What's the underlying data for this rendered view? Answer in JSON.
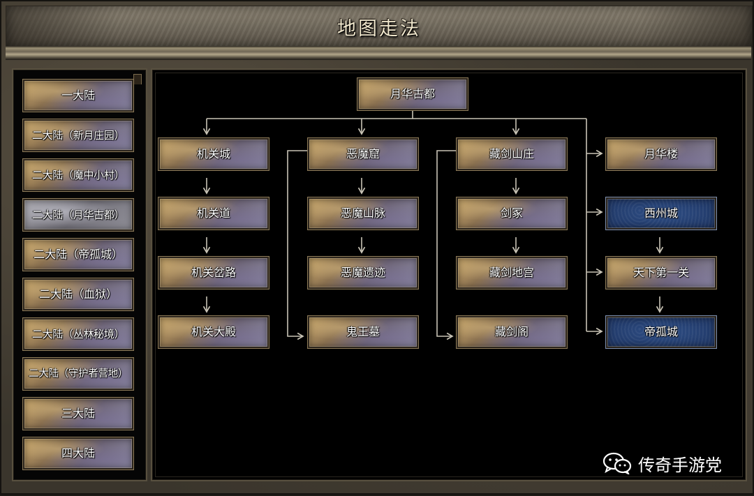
{
  "window": {
    "title": "地图走法"
  },
  "sidebar": {
    "items": [
      {
        "label": "一大陆",
        "style": "gold"
      },
      {
        "label": "二大陆（新月庄园）",
        "style": "gold"
      },
      {
        "label": "二大陆（魔中小村）",
        "style": "gold"
      },
      {
        "label": "二大陆（月华古都）",
        "style": "gray",
        "selected": true
      },
      {
        "label": "二大陆（帝孤城）",
        "style": "gold"
      },
      {
        "label": "二大陆（血狱）",
        "style": "gold"
      },
      {
        "label": "二大陆（丛林秘境）",
        "style": "gold"
      },
      {
        "label": "二大陆（守护者营地）",
        "style": "gold"
      },
      {
        "label": "三大陆",
        "style": "gold"
      },
      {
        "label": "四大陆",
        "style": "gold"
      }
    ]
  },
  "map": {
    "root": "月华古都",
    "col1": [
      "机关城",
      "机关道",
      "机关岔路",
      "机关大殿"
    ],
    "col2": [
      "恶魔窟",
      "恶魔山脉",
      "恶魔遗迹",
      "鬼王墓"
    ],
    "col3": [
      "藏剑山庄",
      "剑冢",
      "藏剑地宫",
      "藏剑阁"
    ],
    "col4": [
      "月华楼",
      "西州城",
      "天下第一关",
      "帝孤城"
    ],
    "col4_styles": [
      "gold",
      "blue",
      "gold",
      "blue"
    ]
  },
  "watermark": {
    "text": "传奇手游党",
    "icon": "wechat-icon"
  },
  "colors": {
    "link": "#c9c4b6",
    "blue_node": "#2a4578",
    "gold_node": "#a8875a"
  }
}
